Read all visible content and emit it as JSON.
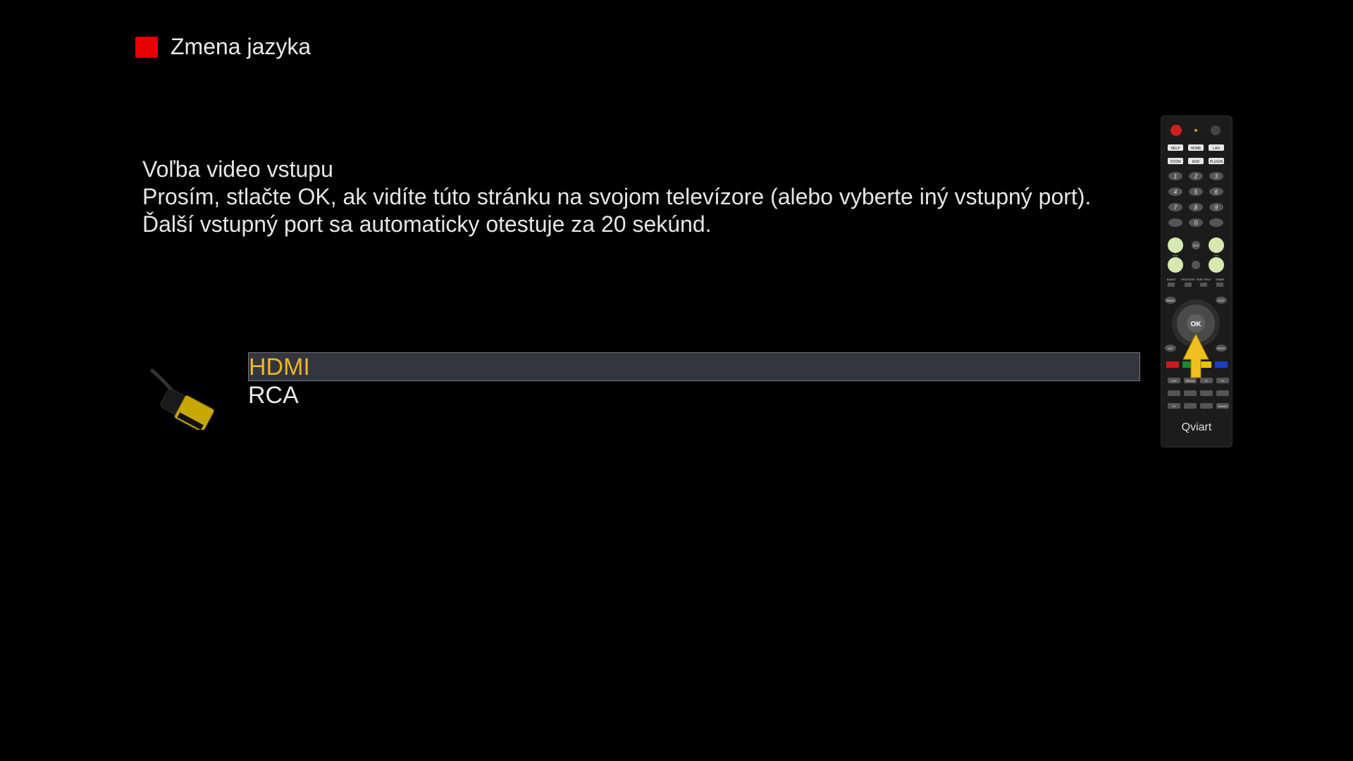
{
  "hint": {
    "label": "Zmena jazyka",
    "key_color": "#e60000"
  },
  "info": {
    "title": "Voľba video vstupu",
    "line1": "Prosím, stlačte OK, ak vidíte túto stránku na svojom televízore (alebo vyberte iný vstupný port).",
    "line2": "Ďalší vstupný port sa automaticky otestuje za 20 sekúnd."
  },
  "inputs": {
    "items": [
      {
        "label": "HDMI",
        "selected": true
      },
      {
        "label": "RCA",
        "selected": false
      }
    ],
    "selected_text_color": "#f0b428"
  },
  "remote": {
    "brand": "Qviart",
    "top_labels": [
      "HELP",
      "HOME",
      "LAN",
      "ZOOM",
      "END",
      "PLUGIN"
    ],
    "digits": [
      "1",
      "2",
      "3",
      "4",
      "5",
      "6",
      "7",
      "8",
      "9",
      "0"
    ],
    "ok_label": "OK",
    "side_labels": [
      "MENU",
      "EXIT",
      "SAT",
      "PROV",
      "EPG",
      "VOL",
      "CH"
    ],
    "func_labels": [
      "AUDIO",
      "TELETEXT",
      "SUB TITLE",
      "TIMER"
    ],
    "bottom_labels": [
      "LIST",
      "MEDIA",
      "F1",
      "F2",
      "TV",
      "RADIO"
    ]
  }
}
